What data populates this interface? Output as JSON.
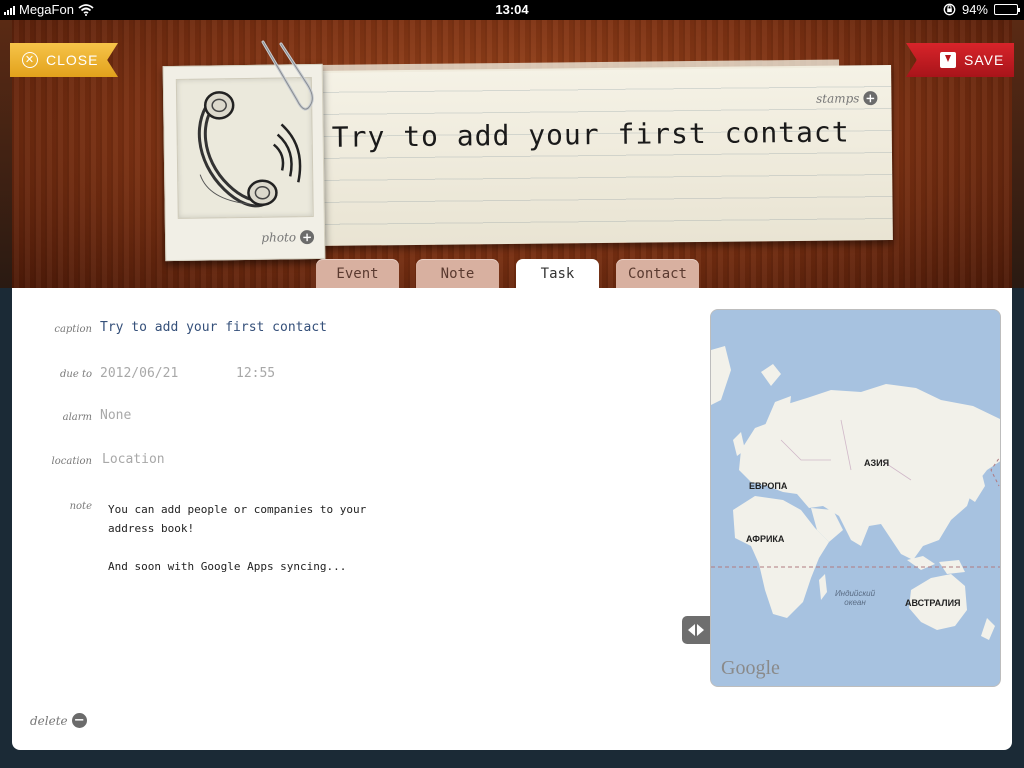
{
  "status_bar": {
    "carrier": "MegaFon",
    "time": "13:04",
    "battery": "94%",
    "battery_level": 0.94,
    "icons": [
      "signal-icon",
      "wifi-icon",
      "rotation-lock-icon",
      "battery-icon"
    ]
  },
  "header": {
    "close_label": "CLOSE",
    "save_label": "SAVE",
    "title": "Try to add your first contact",
    "stamps_label": "stamps",
    "photo_label": "photo"
  },
  "tabs": [
    {
      "label": "Event",
      "active": false
    },
    {
      "label": "Note",
      "active": false
    },
    {
      "label": "Task",
      "active": true
    },
    {
      "label": "Contact",
      "active": false
    }
  ],
  "form": {
    "caption_label": "caption",
    "caption_value": "Try to add your first contact",
    "due_label": "due to",
    "due_date": "2012/06/21",
    "due_time": "12:55",
    "alarm_label": "alarm",
    "alarm_value": "None",
    "location_label": "location",
    "location_placeholder": "Location",
    "note_label": "note",
    "note_line1": "You can add people or companies to your address book!",
    "note_line2": "And soon with Google Apps syncing..."
  },
  "delete_label": "delete",
  "map": {
    "labels": {
      "europe": "ЕВРОПА",
      "asia": "АЗИЯ",
      "africa": "АФРИКА",
      "australia": "АВСТРАЛИЯ",
      "indian_ocean": "Индийский океан"
    },
    "provider": "Google"
  },
  "colors": {
    "close_ribbon": "#f2b630",
    "save_ribbon": "#c81c22",
    "caption_text": "#35507a",
    "map_water": "#a7c2e0",
    "map_land": "#f2f1ea"
  }
}
